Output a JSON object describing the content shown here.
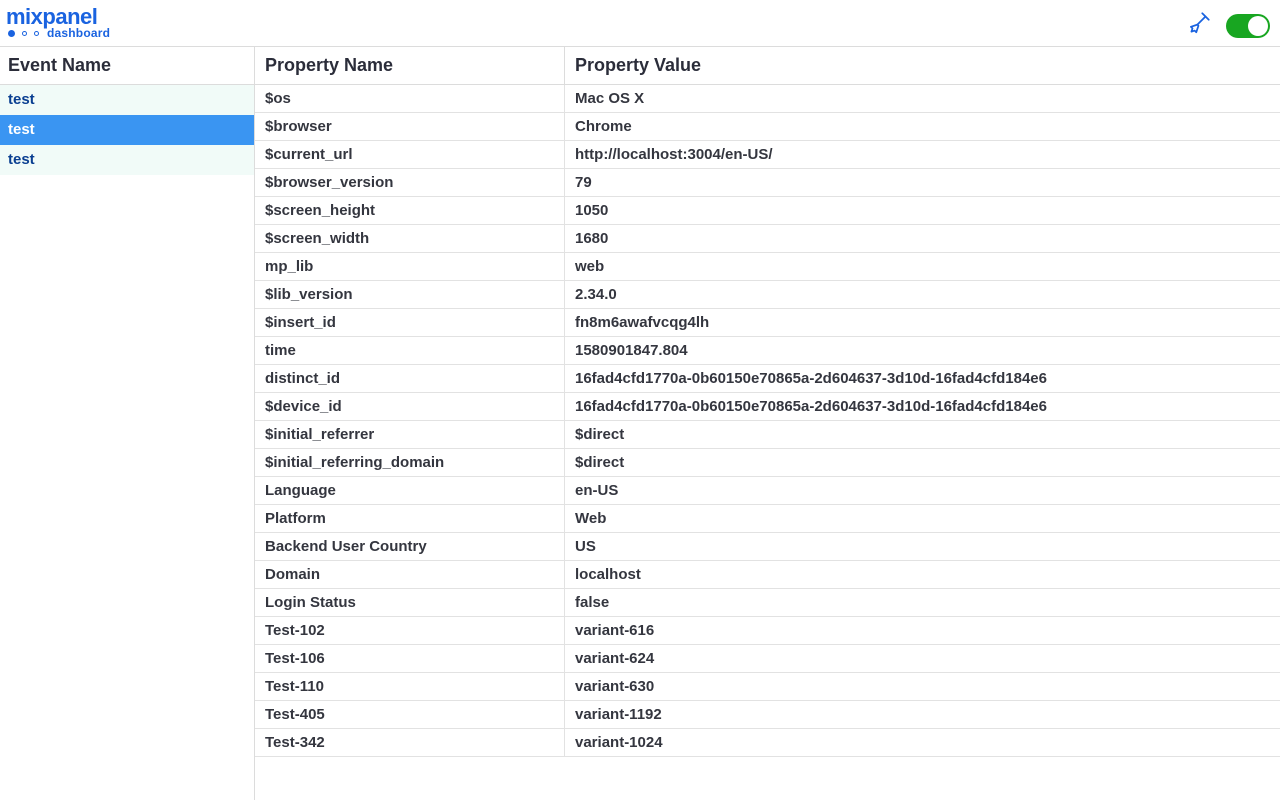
{
  "brand": {
    "word": "mixpanel",
    "subtext": "dashboard"
  },
  "toggle": {
    "on": true
  },
  "columns": {
    "event_header": "Event Name",
    "prop_name_header": "Property Name",
    "prop_value_header": "Property Value"
  },
  "events": [
    {
      "name": "test",
      "selected": false
    },
    {
      "name": "test",
      "selected": true
    },
    {
      "name": "test",
      "selected": false
    }
  ],
  "properties": [
    {
      "name": "$os",
      "value": "Mac OS X"
    },
    {
      "name": "$browser",
      "value": "Chrome"
    },
    {
      "name": "$current_url",
      "value": "http://localhost:3004/en-US/"
    },
    {
      "name": "$browser_version",
      "value": "79"
    },
    {
      "name": "$screen_height",
      "value": "1050"
    },
    {
      "name": "$screen_width",
      "value": "1680"
    },
    {
      "name": "mp_lib",
      "value": "web"
    },
    {
      "name": "$lib_version",
      "value": "2.34.0"
    },
    {
      "name": "$insert_id",
      "value": "fn8m6awafvcqg4lh"
    },
    {
      "name": "time",
      "value": "1580901847.804"
    },
    {
      "name": "distinct_id",
      "value": "16fad4cfd1770a-0b60150e70865a-2d604637-3d10d-16fad4cfd184e6"
    },
    {
      "name": "$device_id",
      "value": "16fad4cfd1770a-0b60150e70865a-2d604637-3d10d-16fad4cfd184e6"
    },
    {
      "name": "$initial_referrer",
      "value": "$direct"
    },
    {
      "name": "$initial_referring_domain",
      "value": "$direct"
    },
    {
      "name": "Language",
      "value": "en-US"
    },
    {
      "name": "Platform",
      "value": "Web"
    },
    {
      "name": "Backend User Country",
      "value": "US"
    },
    {
      "name": "Domain",
      "value": "localhost"
    },
    {
      "name": "Login Status",
      "value": "false"
    },
    {
      "name": "Test-102",
      "value": "variant-616"
    },
    {
      "name": "Test-106",
      "value": "variant-624"
    },
    {
      "name": "Test-110",
      "value": "variant-630"
    },
    {
      "name": "Test-405",
      "value": "variant-1192"
    },
    {
      "name": "Test-342",
      "value": "variant-1024"
    }
  ]
}
